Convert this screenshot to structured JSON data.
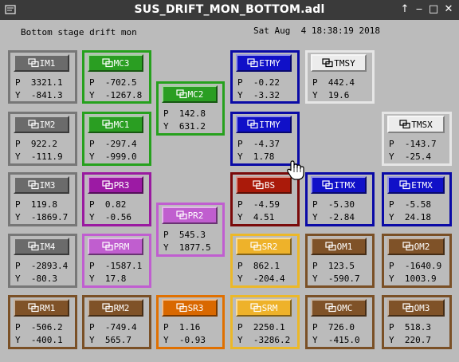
{
  "window": {
    "title": "SUS_DRIFT_MON_BOTTOM.adl",
    "controls": {
      "shade": "↑",
      "minimize": "‒",
      "maximize": "□",
      "close": "✕"
    }
  },
  "header": {
    "subtitle": "Bottom stage drift mon",
    "datetime": "Sat Aug  4 18:38:19 2018"
  },
  "colors": {
    "gray": "#777777",
    "gray_btn": "#6b6b6b",
    "green": "#26a11d",
    "green_btn": "#2a9e22",
    "blue": "#0a0aa6",
    "blue_btn": "#1010c8",
    "purple": "#9a1aa0",
    "purple_btn": "#9c1aa4",
    "lavender": "#c05ed0",
    "lavender_btn": "#c05ecf",
    "white": "#e6e6e6",
    "white_btn": "#ececec",
    "red": "#7a0a0a",
    "red_btn": "#aa1a0a",
    "brown": "#7a5026",
    "brown_btn": "#7f5228",
    "orange": "#e07000",
    "orange_btn": "#d96800",
    "yellow": "#ecb828",
    "yellow_btn": "#eeb22a"
  },
  "panels": [
    {
      "id": "im1",
      "label": "IM1",
      "p": "P  3321.1",
      "y": "Y  -841.3"
    },
    {
      "id": "im2",
      "label": "IM2",
      "p": "P  922.2",
      "y": "Y  -111.9"
    },
    {
      "id": "im3",
      "label": "IM3",
      "p": "P  119.8",
      "y": "Y  -1869.7"
    },
    {
      "id": "im4",
      "label": "IM4",
      "p": "P  -2893.4",
      "y": "Y  -80.3"
    },
    {
      "id": "rm1",
      "label": "RM1",
      "p": "P  -506.2",
      "y": "Y  -400.1"
    },
    {
      "id": "mc3",
      "label": "MC3",
      "p": "P  -702.5",
      "y": "Y  -1267.8"
    },
    {
      "id": "mc1",
      "label": "MC1",
      "p": "P  -297.4",
      "y": "Y  -999.0"
    },
    {
      "id": "pr3",
      "label": "PR3",
      "p": "P  0.82",
      "y": "Y  -0.56"
    },
    {
      "id": "prm",
      "label": "PRM",
      "p": "P  -1587.1",
      "y": "Y  17.8"
    },
    {
      "id": "rm2",
      "label": "RM2",
      "p": "P  -749.4",
      "y": "Y  565.7"
    },
    {
      "id": "mc2",
      "label": "MC2",
      "p": "P  142.8",
      "y": "Y  631.2"
    },
    {
      "id": "pr2",
      "label": "PR2",
      "p": "P  545.3",
      "y": "Y  1877.5"
    },
    {
      "id": "sr3",
      "label": "SR3",
      "p": "P  1.16",
      "y": "Y  -0.93"
    },
    {
      "id": "etmy",
      "label": "ETMY",
      "p": "P  -0.22",
      "y": "Y  -3.32"
    },
    {
      "id": "itmy",
      "label": "ITMY",
      "p": "P  -4.37",
      "y": "Y  1.78"
    },
    {
      "id": "bs",
      "label": "BS",
      "p": "P  -4.59",
      "y": "Y  4.51"
    },
    {
      "id": "sr2",
      "label": "SR2",
      "p": "P  862.1",
      "y": "Y  -204.4"
    },
    {
      "id": "srm",
      "label": "SRM",
      "p": "P  2250.1",
      "y": "Y  -3286.2"
    },
    {
      "id": "tmsy",
      "label": "TMSY",
      "p": "P  442.4",
      "y": "Y  19.6"
    },
    {
      "id": "itmx",
      "label": "ITMX",
      "p": "P  -5.30",
      "y": "Y  -2.84"
    },
    {
      "id": "om1",
      "label": "OM1",
      "p": "P  123.5",
      "y": "Y  -590.7"
    },
    {
      "id": "omc",
      "label": "OMC",
      "p": "P  726.0",
      "y": "Y  -415.0"
    },
    {
      "id": "tmsx",
      "label": "TMSX",
      "p": "P  -143.7",
      "y": "Y  -25.4"
    },
    {
      "id": "etmx",
      "label": "ETMX",
      "p": "P  -5.58",
      "y": "Y  24.18"
    },
    {
      "id": "om2",
      "label": "OM2",
      "p": "P  -1640.9",
      "y": "Y  1003.9"
    },
    {
      "id": "om3",
      "label": "OM3",
      "p": "P  518.3",
      "y": "Y  220.7"
    }
  ]
}
